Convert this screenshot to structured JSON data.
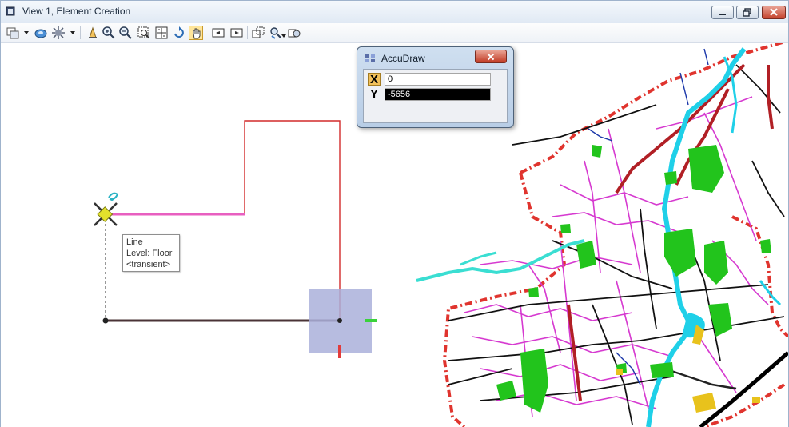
{
  "window": {
    "title": "View 1, Element Creation",
    "controls": [
      "minimize",
      "restore",
      "close"
    ]
  },
  "toolbar": {
    "tools": [
      {
        "name": "view-display-icon",
        "has_dropdown": true
      },
      {
        "name": "display-style-icon",
        "has_dropdown": false
      },
      {
        "name": "view-attributes-icon",
        "has_dropdown": true
      },
      {
        "name": "update-view-icon",
        "has_dropdown": false
      },
      {
        "name": "zoom-in-icon",
        "has_dropdown": false
      },
      {
        "name": "zoom-out-icon",
        "has_dropdown": false
      },
      {
        "name": "window-area-icon",
        "has_dropdown": false
      },
      {
        "name": "fit-view-icon",
        "has_dropdown": false
      },
      {
        "name": "rotate-view-icon",
        "has_dropdown": false
      },
      {
        "name": "pan-view-icon",
        "has_dropdown": false,
        "active": true
      },
      {
        "name": "view-previous-icon",
        "has_dropdown": false
      },
      {
        "name": "view-next-icon",
        "has_dropdown": false
      },
      {
        "name": "clip-volume-icon",
        "has_dropdown": false
      },
      {
        "name": "camera-icon",
        "has_dropdown": true
      },
      {
        "name": "render-icon",
        "has_dropdown": false
      }
    ]
  },
  "tooltip": {
    "line1": "Line",
    "line2": "Level: Floor",
    "line3": "<transient>"
  },
  "accudraw": {
    "title": "AccuDraw",
    "x_label": "X",
    "x_value": "0",
    "y_label": "Y",
    "y_value": "-5656"
  },
  "colors": {
    "title_bar": "#e6eef8",
    "accent_active_tool": "#ffe59a",
    "close_button": "#c4422c",
    "line_pink": "#e85fc0",
    "line_red": "#d22a2a",
    "compass_fill": "#aab0db"
  }
}
